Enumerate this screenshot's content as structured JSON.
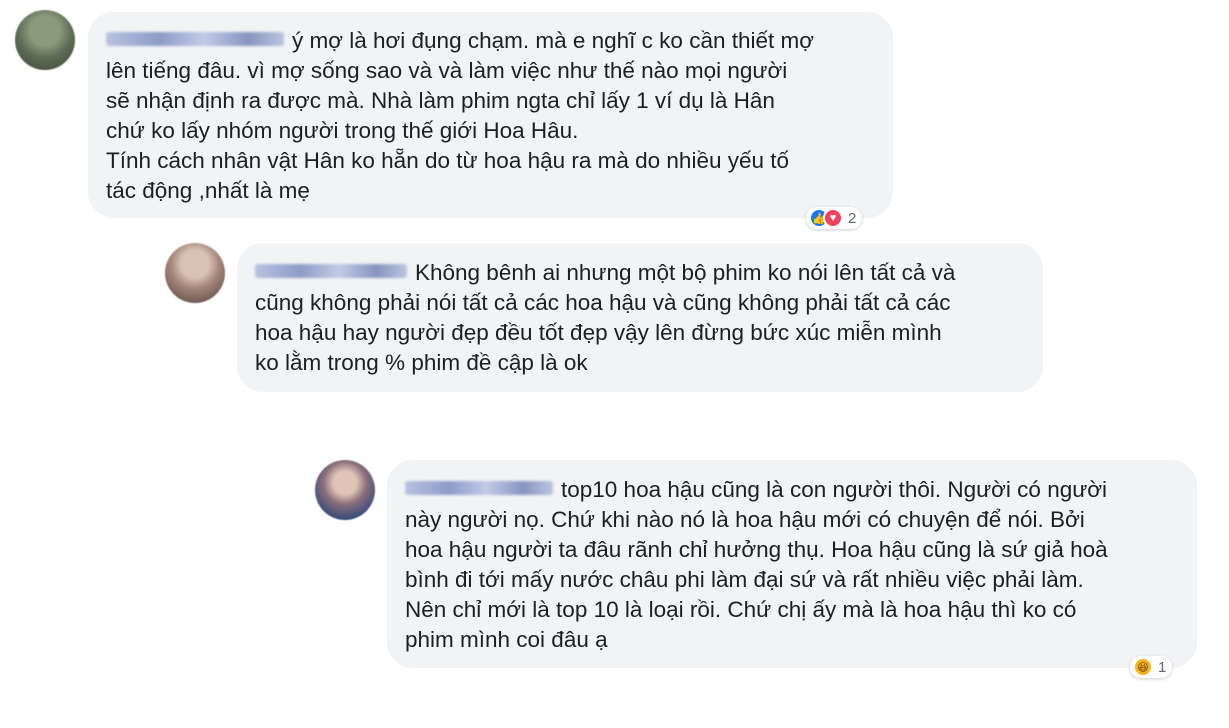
{
  "comments": [
    {
      "author": "",
      "text": "ý mợ là hơi đụng chạm. mà e nghĩ c ko cần thiết mợ\nlên tiếng đâu. vì mợ sống sao và và làm việc như thế nào mọi người\nsẽ nhận định ra được mà. Nhà làm phim ngta chỉ lấy 1 ví dụ là Hân\nchứ ko lấy nhóm người trong thế giới Hoa Hâu.\nTính cách nhân vật Hân ko hẵn do từ hoa hậu ra mà do nhiều yếu tố\ntác động ,nhất là mẹ",
      "reactions": {
        "icons": [
          "like-icon",
          "love-icon"
        ],
        "count": "2"
      }
    },
    {
      "author": "",
      "text": "Không bênh ai nhưng một bộ phim ko nói lên tất cả và\ncũng không phải nói tất cả các hoa hậu và cũng không phải tất cả các\nhoa hậu hay người đẹp đều tốt đẹp vậy lên đừng bức xúc miễn mình\nko lằm trong % phim đề cập là ok"
    },
    {
      "author": "",
      "text": "top10 hoa hậu cũng là con người thôi. Người có người\nnày người nọ. Chứ khi nào nó là hoa hậu mới có chuyện để nói. Bởi\nhoa hậu người ta đâu rãnh chỉ hưởng thụ. Hoa hậu cũng là sứ giả hoà\nbình đi tới mấy nước châu phi làm đại sứ và rất nhiều việc phải làm.\nNên chỉ mới là top 10 là loại rồi. Chứ chị ấy mà là hoa hậu thì ko có\nphim mình coi đâu ạ",
      "reactions": {
        "icons": [
          "haha-icon"
        ],
        "count": "1"
      }
    }
  ],
  "colors": {
    "bubble": "#f2f3f5",
    "text": "#1c1e21",
    "like": "#1877f2",
    "love": "#f3425f",
    "haha": "#f7b125"
  }
}
